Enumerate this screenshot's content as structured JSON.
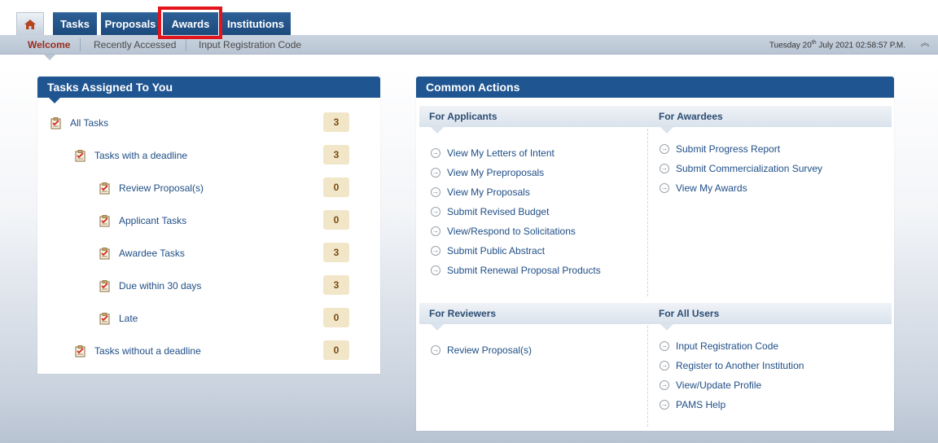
{
  "tabs": {
    "tasks": "Tasks",
    "proposals": "Proposals",
    "awards": "Awards",
    "institutions": "Institutions"
  },
  "subnav": {
    "welcome": "Welcome",
    "recently_accessed": "Recently Accessed",
    "input_registration_code": "Input Registration Code",
    "datetime_prefix": "Tuesday 20",
    "datetime_sup": "th",
    "datetime_suffix": " July 2021 02:58:57 P.M."
  },
  "tasks_panel": {
    "title": "Tasks Assigned To You",
    "items": [
      {
        "label": "All Tasks",
        "count": "3"
      },
      {
        "label": "Tasks with a deadline",
        "count": "3"
      },
      {
        "label": "Review Proposal(s)",
        "count": "0"
      },
      {
        "label": "Applicant Tasks",
        "count": "0"
      },
      {
        "label": "Awardee Tasks",
        "count": "3"
      },
      {
        "label": "Due within 30 days",
        "count": "3"
      },
      {
        "label": "Late",
        "count": "0"
      },
      {
        "label": "Tasks without a deadline",
        "count": "0"
      }
    ]
  },
  "actions_panel": {
    "title": "Common Actions",
    "applicants": {
      "title": "For Applicants",
      "links": [
        "View My Letters of Intent",
        "View My Preproposals",
        "View My Proposals",
        "Submit Revised Budget",
        "View/Respond to Solicitations",
        "Submit Public Abstract",
        "Submit Renewal Proposal Products"
      ]
    },
    "awardees": {
      "title": "For Awardees",
      "links": [
        "Submit Progress Report",
        "Submit Commercialization Survey",
        "View My Awards"
      ]
    },
    "reviewers": {
      "title": "For Reviewers",
      "links": [
        "Review Proposal(s)"
      ]
    },
    "all_users": {
      "title": "For All Users",
      "links": [
        "Input Registration Code",
        "Register to Another Institution",
        "View/Update Profile",
        "PAMS Help"
      ]
    }
  },
  "colors": {
    "header_blue": "#1f5591",
    "highlight_red": "#e3141b",
    "active_subnav": "#9a2b1d"
  }
}
